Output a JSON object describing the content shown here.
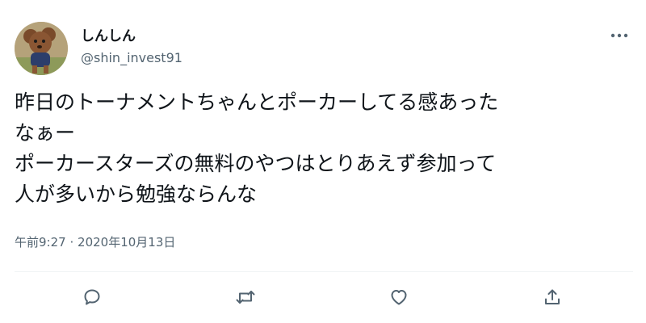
{
  "user": {
    "display_name": "しんしん",
    "handle": "@shin_invest91",
    "avatar_icon": "dog-avatar"
  },
  "tweet": {
    "lines": [
      "昨日のトーナメントちゃんとポーカーしてる感あった",
      "なぁー",
      "ポーカースターズの無料のやつはとりあえず参加って",
      "人が多いから勉強ならんな"
    ],
    "time": "午前9:27",
    "separator": "·",
    "date": "2020年10月13日"
  },
  "actions": [
    "reply-icon",
    "retweet-icon",
    "like-icon",
    "share-icon"
  ],
  "colors": {
    "text": "#0f1419",
    "secondary": "#536471",
    "divider": "#eff3f4"
  }
}
